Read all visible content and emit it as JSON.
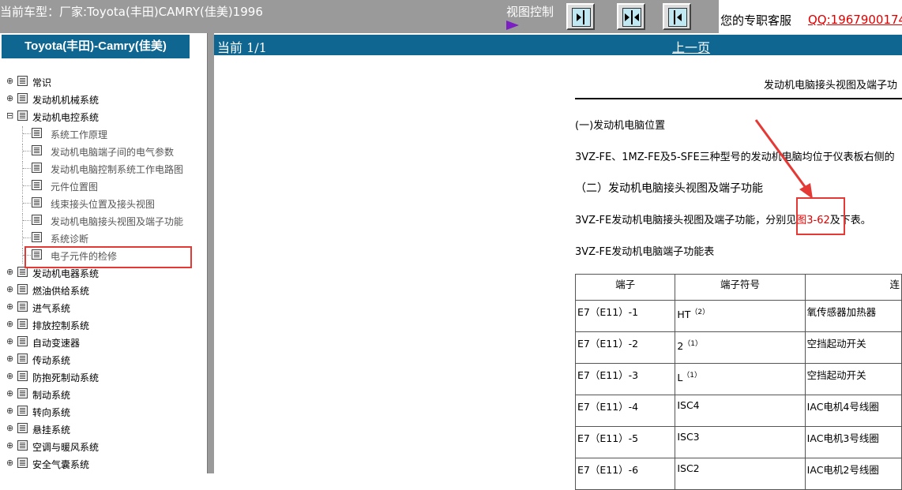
{
  "topbar": {
    "title": "当前车型：厂家:Toyota(丰田)CAMRY(佳美)1996",
    "view_control_label": "视图控制",
    "service_label": "您的专职客服",
    "qq": "QQ:1967900174"
  },
  "sidebar": {
    "brand": "Toyota(丰田)-Camry(佳美)",
    "items": [
      {
        "label": "常识",
        "expander": "+"
      },
      {
        "label": "发动机机械系统",
        "expander": "+"
      },
      {
        "label": "发动机电控系统",
        "expander": "−"
      },
      {
        "label": "系统工作原理"
      },
      {
        "label": "发动机电脑端子间的电气参数"
      },
      {
        "label": "发动机电脑控制系统工作电路图"
      },
      {
        "label": "元件位置图"
      },
      {
        "label": "线束接头位置及接头视图"
      },
      {
        "label": "发动机电脑接头视图及端子功能"
      },
      {
        "label": "系统诊断"
      },
      {
        "label": "电子元件的检修"
      },
      {
        "label": "发动机电器系统",
        "expander": "+"
      },
      {
        "label": "燃油供给系统",
        "expander": "+"
      },
      {
        "label": "进气系统",
        "expander": "+"
      },
      {
        "label": "排放控制系统",
        "expander": "+"
      },
      {
        "label": "自动变速器",
        "expander": "+"
      },
      {
        "label": "传动系统",
        "expander": "+"
      },
      {
        "label": "防抱死制动系统",
        "expander": "+"
      },
      {
        "label": "制动系统",
        "expander": "+"
      },
      {
        "label": "转向系统",
        "expander": "+"
      },
      {
        "label": "悬挂系统",
        "expander": "+"
      },
      {
        "label": "空调与暖风系统",
        "expander": "+"
      },
      {
        "label": "安全气囊系统",
        "expander": "+"
      }
    ]
  },
  "content": {
    "page_indicator": "当前 1/1",
    "prev_page": "上一页",
    "doc_title": "发动机电脑接头视图及端子功",
    "p1": "(一)发动机电脑位置",
    "p2": "3VZ-FE、1MZ-FE及5-SFE三种型号的发动机电脑均位于仪表板右侧的",
    "p3": "（二）发动机电脑接头视图及端子功能",
    "p4_before": "3VZ-FE发动机电脑接头视图及端子功能，分别见",
    "p4_link": "图3-62",
    "p4_after": "及下表。",
    "p5": "3VZ-FE发动机电脑端子功能表",
    "table": {
      "headers": [
        "端子",
        "端子符号",
        "连"
      ],
      "rows": [
        {
          "terminal": "E7（E11）-1",
          "symbol": "HT",
          "sup": "（2）",
          "func": "氧传感器加热器"
        },
        {
          "terminal": "E7（E11）-2",
          "symbol": "2",
          "sup": "（1）",
          "func": "空挡起动开关"
        },
        {
          "terminal": "E7（E11）-3",
          "symbol": "L",
          "sup": "（1）",
          "func": "空挡起动开关"
        },
        {
          "terminal": "E7（E11）-4",
          "symbol": "ISC4",
          "sup": "",
          "func": "IAC电机4号线圈"
        },
        {
          "terminal": "E7（E11）-5",
          "symbol": "ISC3",
          "sup": "",
          "func": "IAC电机3号线圈"
        },
        {
          "terminal": "E7（E11）-6",
          "symbol": "ISC2",
          "sup": "",
          "func": "IAC电机2号线圈"
        }
      ]
    }
  },
  "colors": {
    "brand_blue": "#0e6691",
    "highlight_red": "#e53935",
    "link_red": "#e00000"
  }
}
